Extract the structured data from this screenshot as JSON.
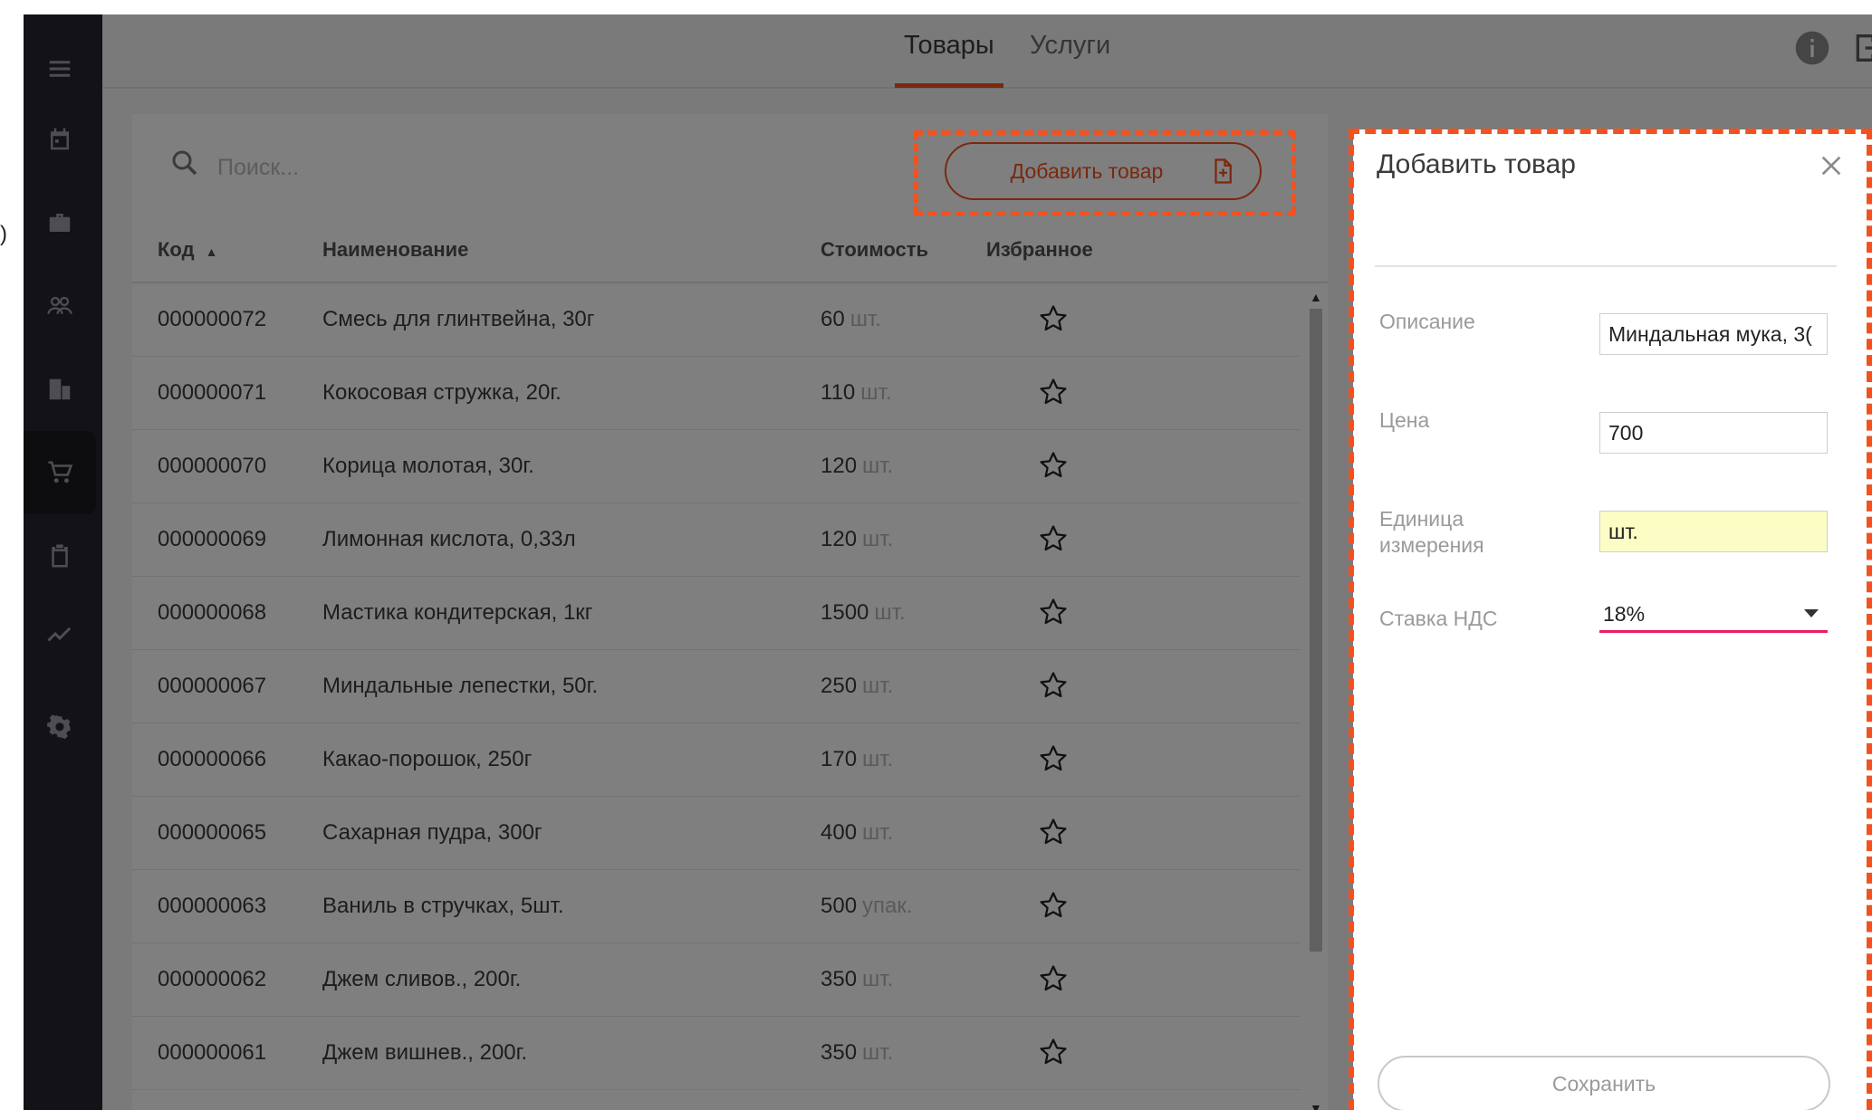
{
  "tabs": [
    {
      "label": "Товары",
      "active": true
    },
    {
      "label": "Услуги",
      "active": false
    }
  ],
  "sidebar": {
    "items": [
      {
        "icon": "menu-icon"
      },
      {
        "icon": "calendar-icon"
      },
      {
        "icon": "briefcase-icon"
      },
      {
        "icon": "people-icon"
      },
      {
        "icon": "building-icon"
      },
      {
        "icon": "cart-icon",
        "active": true
      },
      {
        "icon": "clipboard-icon"
      },
      {
        "icon": "chart-line-icon"
      },
      {
        "icon": "gear-icon"
      }
    ]
  },
  "toolbar": {
    "search_placeholder": "Поиск...",
    "add_button_label": "Добавить товар"
  },
  "table": {
    "columns": [
      "Код",
      "Наименование",
      "Стоимость",
      "Избранное"
    ],
    "sort_column": "Код",
    "sort_direction": "ascending",
    "rows": [
      {
        "code": "000000072",
        "name": "Смесь для глинтвейна, 30г",
        "price": "60",
        "unit": "шт."
      },
      {
        "code": "000000071",
        "name": "Кокосовая стружка, 20г.",
        "price": "110",
        "unit": "шт."
      },
      {
        "code": "000000070",
        "name": "Корица молотая, 30г.",
        "price": "120",
        "unit": "шт."
      },
      {
        "code": "000000069",
        "name": "Лимонная кислота, 0,33л",
        "price": "120",
        "unit": "шт."
      },
      {
        "code": "000000068",
        "name": "Мастика кондитерская, 1кг",
        "price": "1500",
        "unit": "шт."
      },
      {
        "code": "000000067",
        "name": "Миндальные лепестки, 50г.",
        "price": "250",
        "unit": "шт."
      },
      {
        "code": "000000066",
        "name": "Какао-порошок, 250г",
        "price": "170",
        "unit": "шт."
      },
      {
        "code": "000000065",
        "name": "Сахарная пудра, 300г",
        "price": "400",
        "unit": "шт."
      },
      {
        "code": "000000063",
        "name": "Ваниль в стручках, 5шт.",
        "price": "500",
        "unit": "упак."
      },
      {
        "code": "000000062",
        "name": "Джем сливов., 200г.",
        "price": "350",
        "unit": "шт."
      },
      {
        "code": "000000061",
        "name": "Джем вишнев., 200г.",
        "price": "350",
        "unit": "шт."
      }
    ]
  },
  "panel": {
    "title": "Добавить товар",
    "fields": {
      "description_label": "Описание",
      "description_value": "Миндальная мука, 3(",
      "price_label": "Цена",
      "price_value": "700",
      "unit_label_line1": "Единица",
      "unit_label_line2": "измерения",
      "unit_value": "шт.",
      "vat_label": "Ставка НДС",
      "vat_value": "18%"
    },
    "save_label": "Сохранить"
  },
  "colors": {
    "accent": "#f4511e",
    "select_underline": "#e91e63",
    "sidebar_bg": "#26262e",
    "highlight_input": "#fbfdc4"
  }
}
